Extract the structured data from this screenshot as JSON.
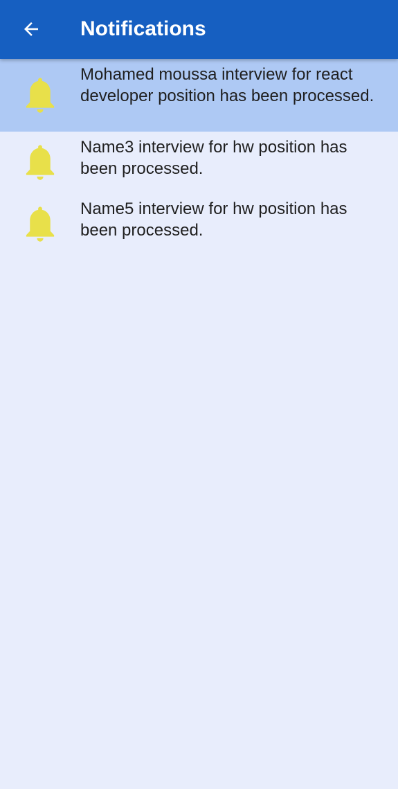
{
  "app_bar": {
    "title": "Notifications",
    "back_icon": "arrow-left-icon",
    "background_color": "#165fc1"
  },
  "notifications": [
    {
      "icon": "bell-icon",
      "text": "Mohamed moussa interview for react developer position has been processed.",
      "highlighted": true
    },
    {
      "icon": "bell-icon",
      "text": "Name3 interview for hw position has been processed.",
      "highlighted": false
    },
    {
      "icon": "bell-icon",
      "text": "Name5 interview for hw position has been processed.",
      "highlighted": false
    }
  ],
  "colors": {
    "page_background": "#e8edfc",
    "highlight_background": "#aec9f4",
    "bell_color": "#e8e04a",
    "text_color": "#1f1f1f"
  }
}
